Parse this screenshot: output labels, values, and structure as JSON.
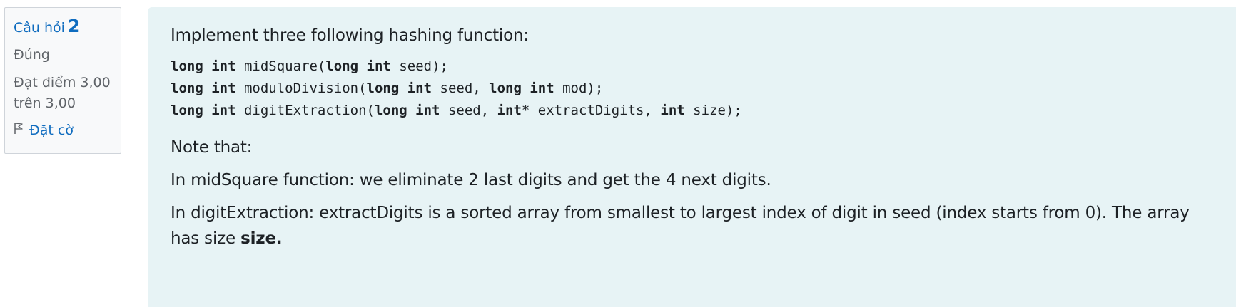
{
  "info": {
    "question_label": "Câu hỏi",
    "question_number": "2",
    "state": "Đúng",
    "grade_line1": "Đạt điểm 3,00",
    "grade_line2": "trên 3,00",
    "flag_label": "Đặt cờ",
    "flag_icon": "flag-outline-icon"
  },
  "question": {
    "intro": "Implement three following hashing function:",
    "code_lines": [
      [
        {
          "t": "long int",
          "kw": true
        },
        {
          "t": " midSquare(",
          "kw": false
        },
        {
          "t": "long int",
          "kw": true
        },
        {
          "t": " seed);",
          "kw": false
        }
      ],
      [
        {
          "t": "long int",
          "kw": true
        },
        {
          "t": " moduloDivision(",
          "kw": false
        },
        {
          "t": "long int",
          "kw": true
        },
        {
          "t": " seed, ",
          "kw": false
        },
        {
          "t": "long int",
          "kw": true
        },
        {
          "t": " mod);",
          "kw": false
        }
      ],
      [
        {
          "t": "long int",
          "kw": true
        },
        {
          "t": " digitExtraction(",
          "kw": false
        },
        {
          "t": "long int",
          "kw": true
        },
        {
          "t": " seed, ",
          "kw": false
        },
        {
          "t": "int",
          "kw": true
        },
        {
          "t": "* extractDigits, ",
          "kw": false
        },
        {
          "t": "int",
          "kw": true
        },
        {
          "t": " size);",
          "kw": false
        }
      ]
    ],
    "note_heading": "Note that:",
    "paragraph1": "In midSquare function: we eliminate 2 last digits and get the 4 next digits.",
    "paragraph2_text": "In digitExtraction: extractDigits is a sorted array from smallest to largest index of digit in seed (index starts from 0). The array has size ",
    "paragraph2_bold": "size."
  },
  "colors": {
    "link": "#0f6cbf",
    "content_bg": "#e7f3f5",
    "info_bg": "#f8f9fa",
    "text": "#1d2125"
  }
}
